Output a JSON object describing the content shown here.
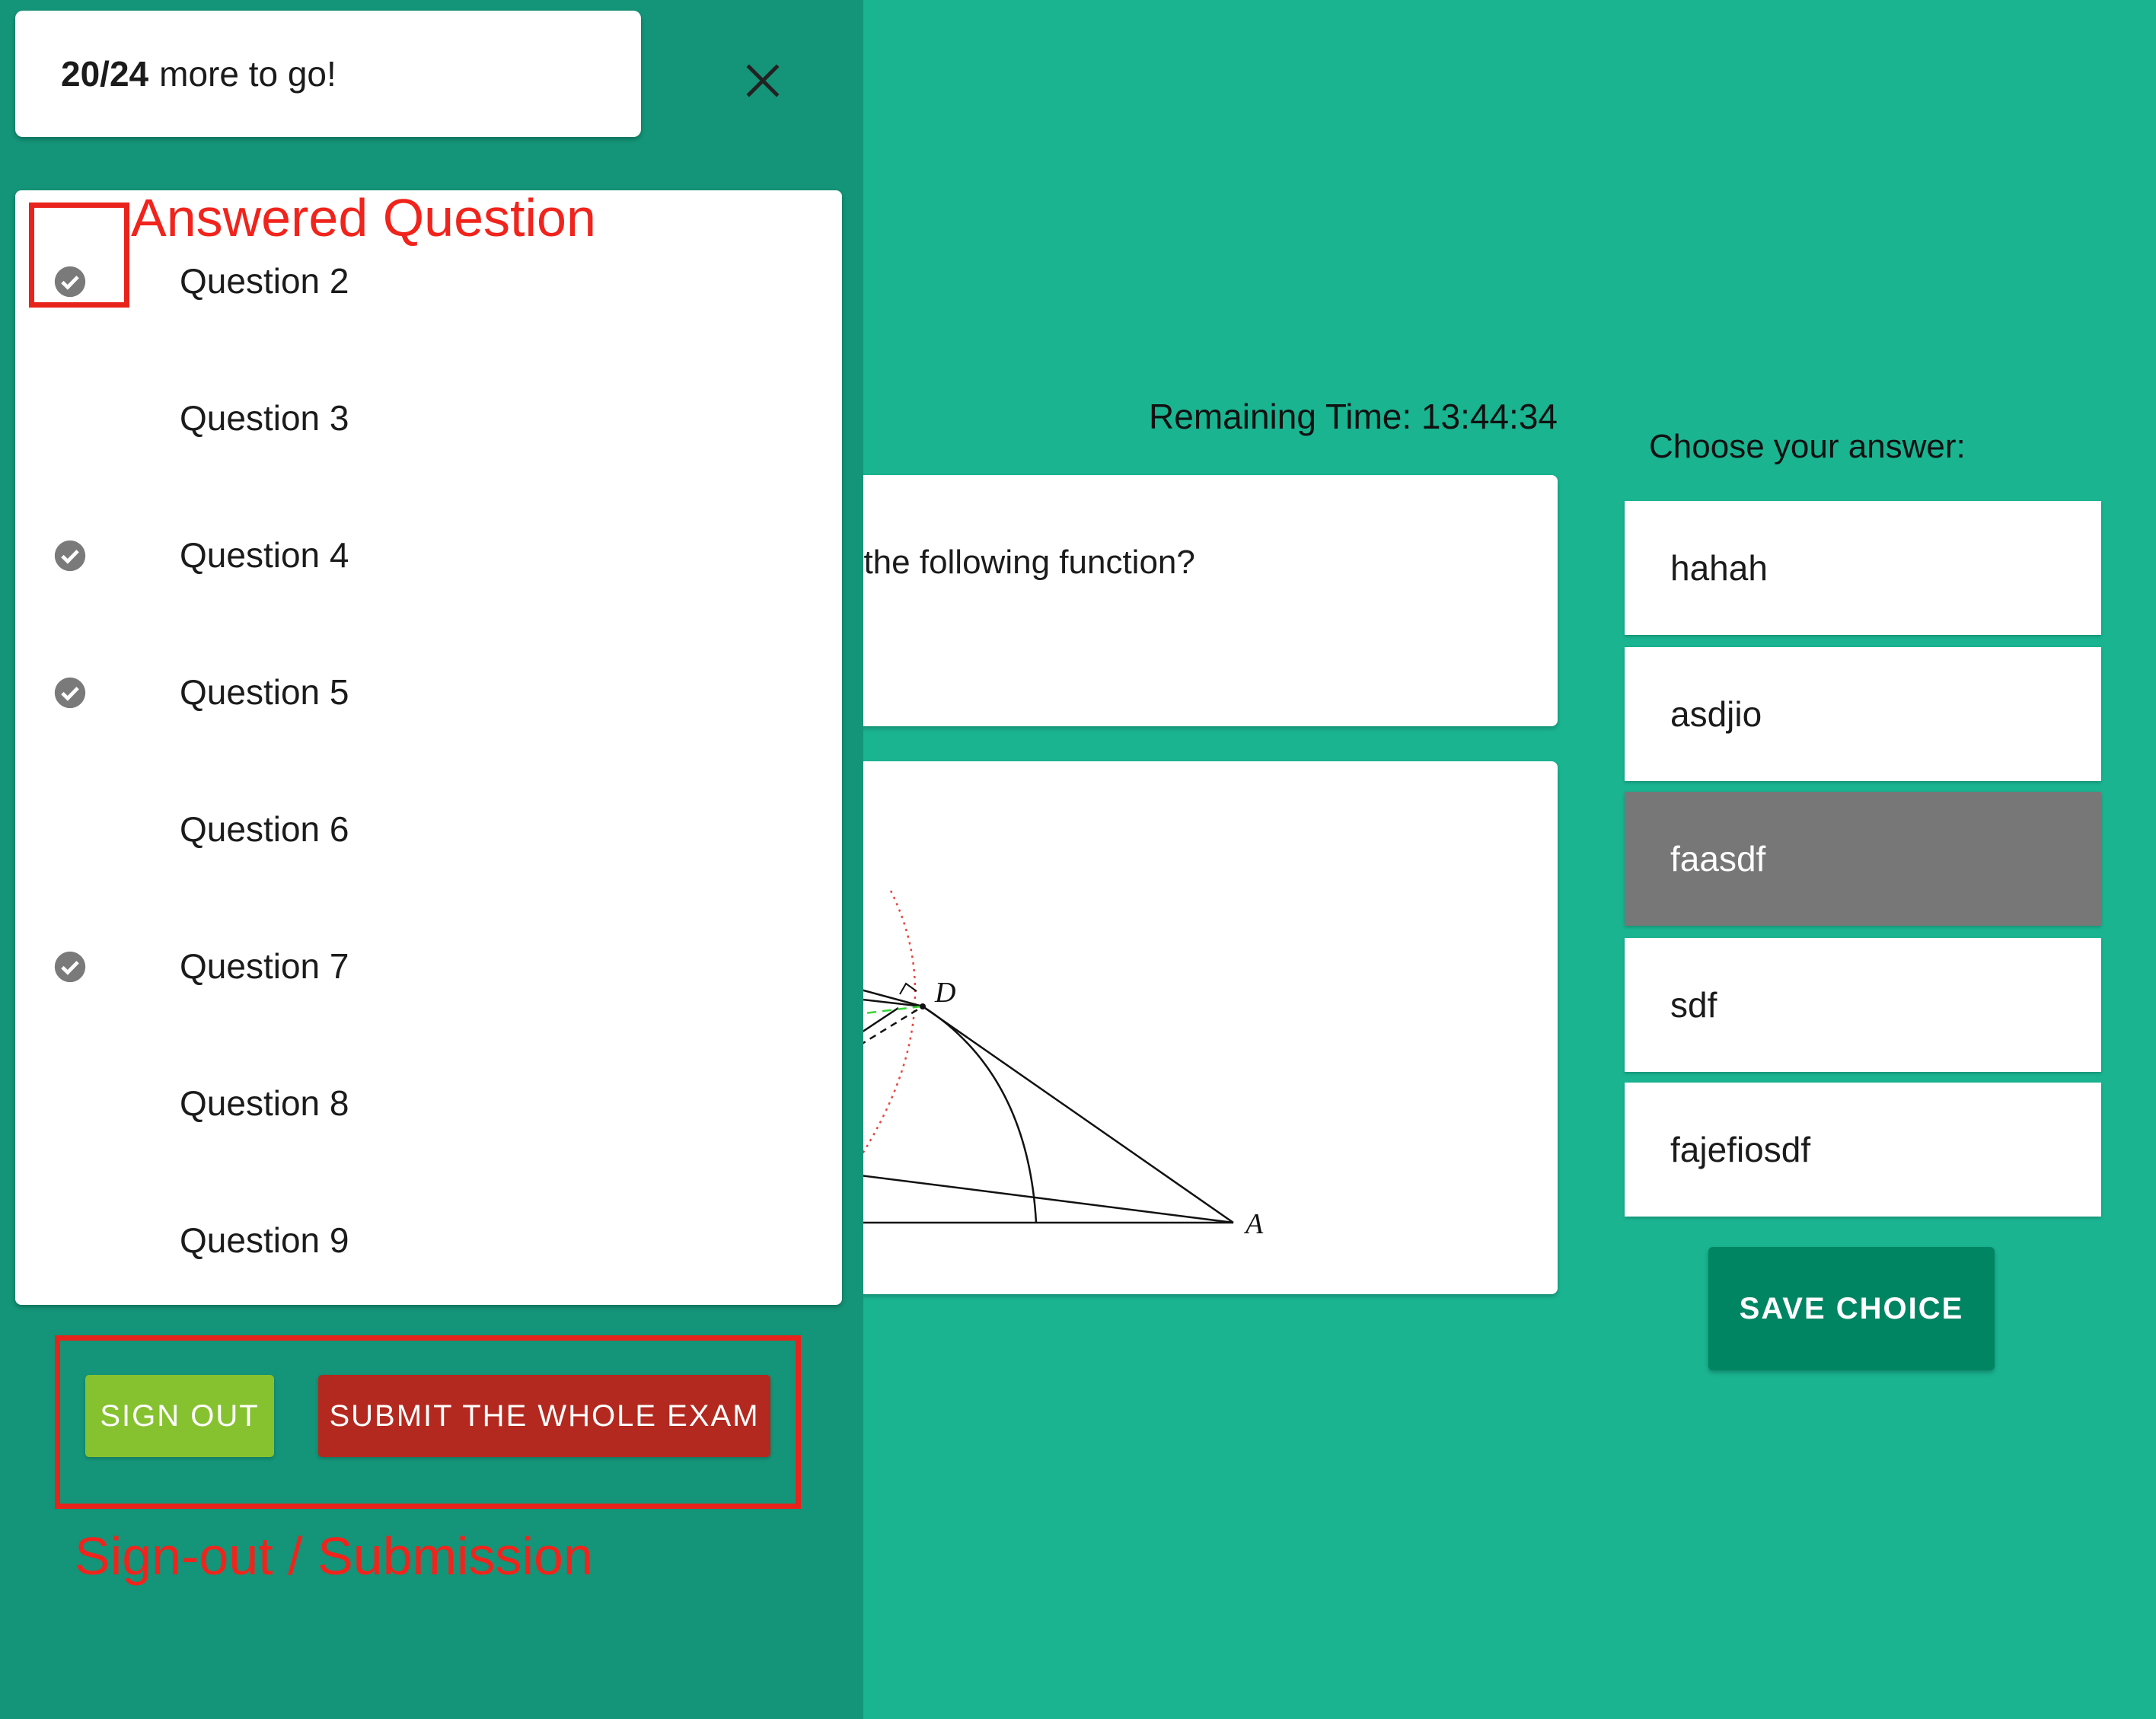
{
  "drawer": {
    "progress": {
      "count": "20/24",
      "suffix": "more to go!",
      "answered": 20,
      "total": 24
    },
    "close_icon": "close-icon",
    "questions": [
      {
        "label": "Question 2",
        "answered": true
      },
      {
        "label": "Question 3",
        "answered": false
      },
      {
        "label": "Question 4",
        "answered": true
      },
      {
        "label": "Question 5",
        "answered": true
      },
      {
        "label": "Question 6",
        "answered": false
      },
      {
        "label": "Question 7",
        "answered": true
      },
      {
        "label": "Question 8",
        "answered": false
      },
      {
        "label": "Question 9",
        "answered": false
      }
    ],
    "sign_out_label": "SIGN OUT",
    "submit_label": "SUBMIT THE WHOLE EXAM"
  },
  "main": {
    "timer_label": "Remaining Time: 13:44:34",
    "question_text": "f the following function?",
    "question_math_fragment": ")",
    "figure_labels": {
      "d": "D",
      "a": "A"
    },
    "choose_label": "Choose your answer:",
    "answers": [
      {
        "label": "hahah",
        "selected": false
      },
      {
        "label": "asdjio",
        "selected": false
      },
      {
        "label": "faasdf",
        "selected": true
      },
      {
        "label": "sdf",
        "selected": false
      },
      {
        "label": "fajefiosdf",
        "selected": false
      }
    ],
    "save_label": "SAVE CHOICE"
  },
  "annotations": {
    "answered_question": "Answered Question",
    "sign_out_submission": "Sign-out / Submission"
  },
  "colors": {
    "background": "#1ab491",
    "drawer": "#149478",
    "save_button": "#008563",
    "sign_out_button": "#86c230",
    "submit_button": "#b3291f",
    "selected_answer": "#777777",
    "annotation": "#e8231b"
  }
}
